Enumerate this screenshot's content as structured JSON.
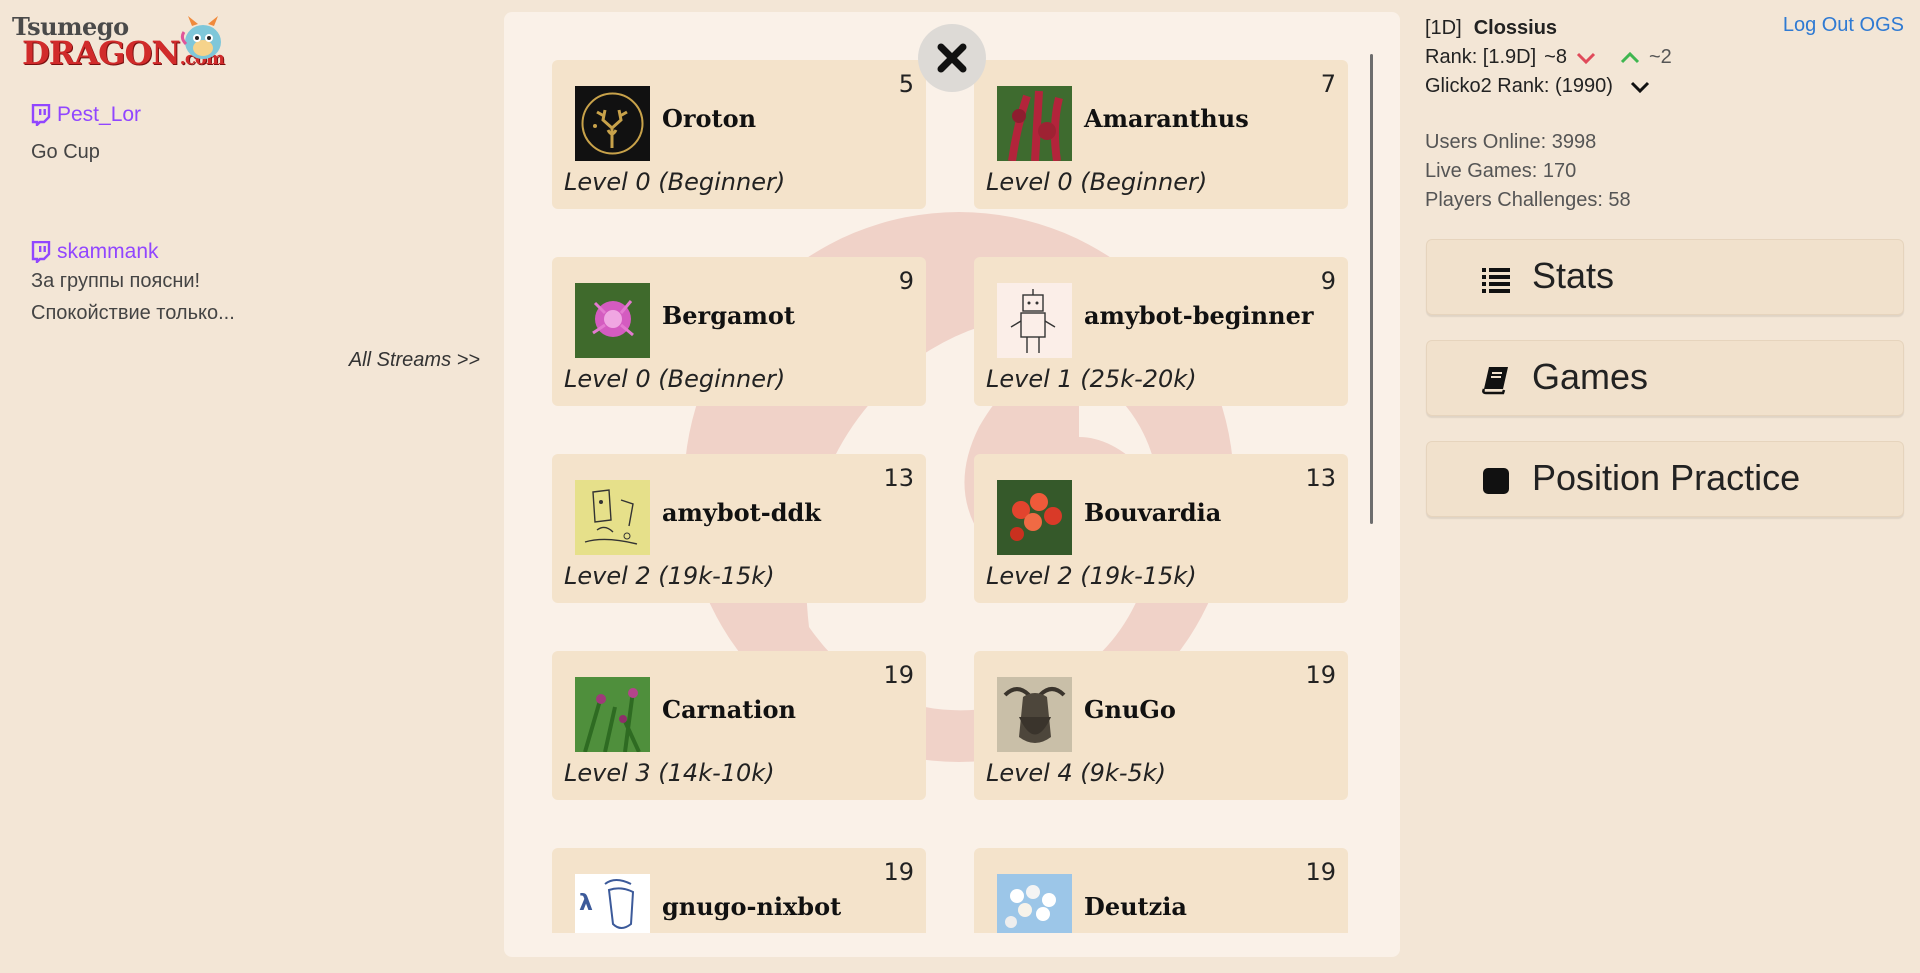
{
  "logo": {
    "line1": "Tsumego",
    "line2": "DRAGON",
    "line2_suffix": ".com"
  },
  "streams": [
    {
      "name": "Pest_Lor",
      "lines": [
        "Go Cup"
      ]
    },
    {
      "name": "skammank",
      "lines": [
        "За группы поясни!",
        "Спокойствие только..."
      ]
    }
  ],
  "all_streams": "All Streams >>",
  "bots": [
    {
      "name": "Oroton",
      "count": "5",
      "level": "Level 0 (Beginner)",
      "avatar": "deer-logo-icon"
    },
    {
      "name": "Amaranthus",
      "count": "7",
      "level": "Level 0 (Beginner)",
      "avatar": "amaranthus-flower-icon"
    },
    {
      "name": "Bergamot",
      "count": "9",
      "level": "Level 0 (Beginner)",
      "avatar": "bergamot-flower-icon"
    },
    {
      "name": "amybot-beginner",
      "count": "9",
      "level": "Level 1 (25k-20k)",
      "avatar": "robot-sketch-icon"
    },
    {
      "name": "amybot-ddk",
      "count": "13",
      "level": "Level 2 (19k-15k)",
      "avatar": "sketch-drawing-icon"
    },
    {
      "name": "Bouvardia",
      "count": "13",
      "level": "Level 2 (19k-15k)",
      "avatar": "bouvardia-flower-icon"
    },
    {
      "name": "Carnation",
      "count": "19",
      "level": "Level 3 (14k-10k)",
      "avatar": "carnation-flower-icon"
    },
    {
      "name": "GnuGo",
      "count": "19",
      "level": "Level 4 (9k-5k)",
      "avatar": "gnu-icon"
    },
    {
      "name": "gnugo-nixbot",
      "count": "19",
      "level": "",
      "avatar": "lambda-gnu-icon"
    },
    {
      "name": "Deutzia",
      "count": "19",
      "level": "",
      "avatar": "deutzia-flower-icon"
    }
  ],
  "user": {
    "rank_tag": "[1D]",
    "username": "Clossius",
    "rank_label": "Rank: [1.9D]",
    "rank_down": "~8",
    "rank_up": "~2",
    "glicko": "Glicko2 Rank: (1990)",
    "logout": "Log Out OGS"
  },
  "site_stats": {
    "users_online": "Users Online: 3998",
    "live_games": "Live Games: 170",
    "challenges": "Players Challenges: 58"
  },
  "menu": {
    "stats": "Stats",
    "games": "Games",
    "practice": "Position Practice"
  },
  "colors": {
    "page_bg": "#f3e6d6",
    "card_bg": "#f4e3cb",
    "twitch": "#9146ff",
    "link": "#2f7ad3",
    "down": "#e04a5a",
    "up": "#3fb650"
  }
}
